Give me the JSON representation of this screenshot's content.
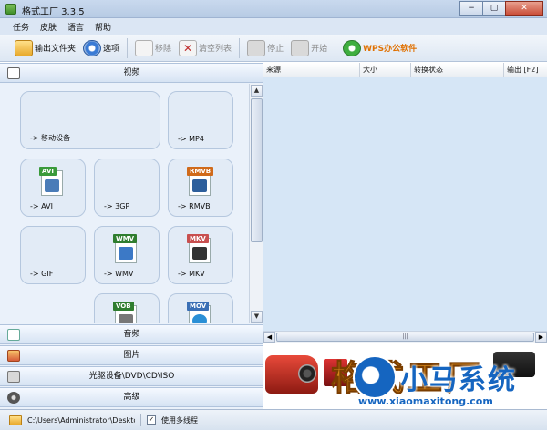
{
  "window": {
    "title": "格式工厂 3.3.5",
    "buttons": [
      "−",
      "▢",
      "✕"
    ]
  },
  "menu": [
    "任务",
    "皮肤",
    "语言",
    "帮助"
  ],
  "toolbar": {
    "output_folder": "输出文件夹",
    "options": "选项",
    "remove": "移除",
    "clear_list": "清空列表",
    "stop": "停止",
    "start": "开始",
    "wps": "WPS办公软件"
  },
  "categories": {
    "video": "视频",
    "audio": "音频",
    "picture": "图片",
    "disc": "光驱设备\\DVD\\CD\\ISO",
    "advanced": "高级"
  },
  "video_tiles": [
    {
      "label": "-> 移动设备",
      "icon": "mobile-device-icon"
    },
    {
      "label": "-> MP4",
      "icon": "mp4-icon"
    },
    {
      "label": "-> AVI",
      "tag": "AVI",
      "tag_color": "#3a9a3a",
      "pic_color": "#4a7cb8"
    },
    {
      "label": "-> 3GP",
      "icon": "3gp-icon"
    },
    {
      "label": "-> RMVB",
      "tag": "RMVB",
      "tag_color": "#d06a1a",
      "pic_color": "#2e5f9c"
    },
    {
      "label": "-> GIF",
      "icon": "gif-icon"
    },
    {
      "label": "-> WMV",
      "tag": "WMV",
      "tag_color": "#2f7d2f",
      "pic_color": "#3c79c6"
    },
    {
      "label": "-> MKV",
      "tag": "MKV",
      "tag_color": "#c84f4f",
      "pic_color": "#333333"
    },
    {
      "label": "",
      "tag": "VOB",
      "tag_color": "#2f7d2f",
      "pic_color": "#777777"
    },
    {
      "label": "",
      "tag": "MOV",
      "tag_color": "#3a6fb5",
      "pic_color": "#2a8fd6"
    }
  ],
  "table": {
    "columns": [
      "来源",
      "大小",
      "转换状态",
      "输出 [F2]"
    ]
  },
  "hscroll_grip": "|||",
  "banner": {
    "product_text": "格式工厂",
    "watermark_cn": "小马系统",
    "watermark_url": "www.xiaomaxitong.com"
  },
  "status": {
    "path": "C:\\Users\\Administrator\\Desktop",
    "multithread_label": "使用多线程",
    "multithread_checked": "✓"
  }
}
